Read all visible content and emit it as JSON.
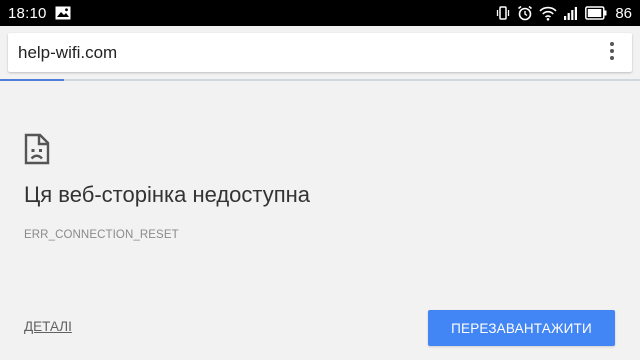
{
  "status_bar": {
    "time": "18:10",
    "battery_percent": "86",
    "icons": [
      "image-notification-icon",
      "vibrate-icon",
      "alarm-icon",
      "wifi-icon",
      "signal-icon",
      "battery-icon"
    ]
  },
  "browser": {
    "url": "help-wifi.com",
    "menu_icon": "more-vert-icon",
    "load_progress": 0.1
  },
  "error_page": {
    "icon": "sad-page-icon",
    "title": "Ця веб-сторінка недоступна",
    "error_code": "ERR_CONNECTION_RESET",
    "details_label": "ДЕТАЛІ",
    "reload_label": "ПЕРЕЗАВАНТАЖИТИ"
  },
  "colors": {
    "accent": "#4285f4",
    "progress": "#4d7fd6",
    "background": "#f2f2f2",
    "status_bar": "#000000"
  }
}
